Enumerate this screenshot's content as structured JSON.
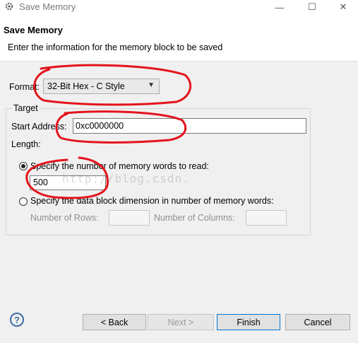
{
  "window": {
    "title": "Save Memory",
    "minimize_glyph": "—",
    "maximize_glyph": "☐",
    "close_glyph": "✕"
  },
  "header": {
    "title": "Save Memory",
    "description": "Enter the information for the memory block to be saved"
  },
  "form": {
    "format_label": "Format:",
    "format_value": "32-Bit Hex - C Style",
    "target_legend": "Target",
    "start_address_label": "Start Address:",
    "start_address_value": "0xc0000000",
    "length_label": "Length:",
    "option_words_label": "Specify the number of memory words to read:",
    "words_value": "500",
    "option_block_label": "Specify the data block dimension in number of memory words:",
    "rows_label": "Number of Rows:",
    "columns_label": "Number of Columns:"
  },
  "watermark": "http://blog.csdn.",
  "buttons": {
    "help": "?",
    "back": "< Back",
    "next": "Next >",
    "finish": "Finish",
    "cancel": "Cancel"
  },
  "colors": {
    "annotation_red": "#e4141c",
    "accent_blue": "#0078d7"
  },
  "icons": {
    "app": "gear-icon",
    "dropdown": "chevron-down-icon"
  }
}
